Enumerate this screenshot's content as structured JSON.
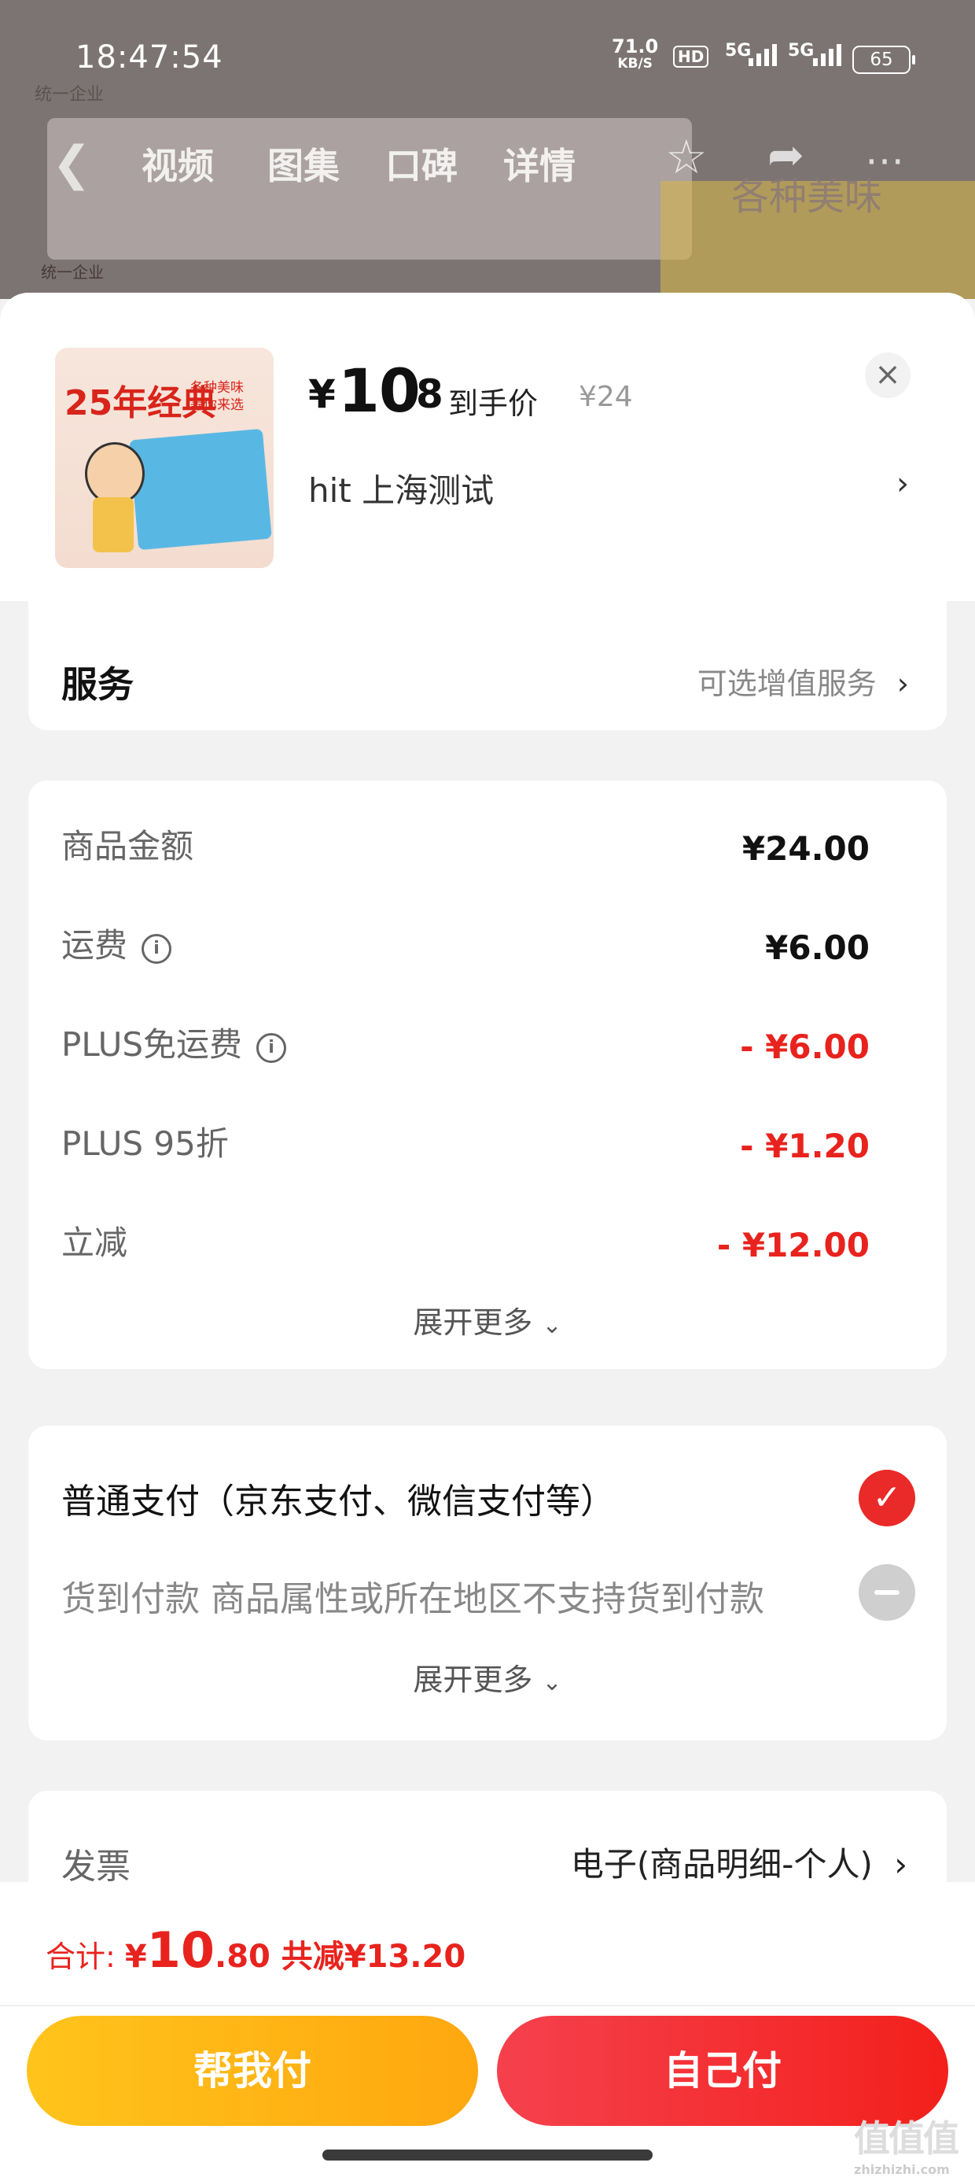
{
  "background": {
    "brand_top": "统一企业",
    "brand_bottom": "统一企业",
    "slogan": "各种美味"
  },
  "status_bar": {
    "time": "18:47:54",
    "net_speed": "71.0",
    "net_unit": "KB/S",
    "hd": "HD",
    "sig1": "5G",
    "sig2": "5G",
    "battery": "65"
  },
  "nav": {
    "tabs": [
      "视频",
      "图集",
      "口碑",
      "详情"
    ]
  },
  "product": {
    "thumb_title": "25年经典",
    "thumb_sub1": "各种美味",
    "thumb_sub2": "等你来选",
    "price_symbol": "¥",
    "price_int": "10",
    "price_dec": ".8",
    "price_label": "到手价",
    "original_price": "¥24",
    "address": "hit  上海测试"
  },
  "service": {
    "title": "服务",
    "right_label": "可选增值服务"
  },
  "fees": {
    "rows": [
      {
        "label": "商品金额",
        "value": "¥24.00"
      },
      {
        "label": "运费",
        "value": "¥6.00"
      },
      {
        "label": "PLUS免运费",
        "value": "- ¥6.00"
      },
      {
        "label": "PLUS 95折",
        "value": "- ¥1.20"
      },
      {
        "label": "立减",
        "value": "- ¥12.00"
      }
    ],
    "expand_label": "展开更多"
  },
  "payment": {
    "option1": "普通支付（京东支付、微信支付等）",
    "option2": "货到付款 商品属性或所在地区不支持货到付款",
    "expand_label": "展开更多"
  },
  "invoice": {
    "label": "发票",
    "value": "电子(商品明细-个人)"
  },
  "footer": {
    "total_label": "合计: ",
    "total_symbol": "¥",
    "total_int": "10",
    "total_dec": ".80",
    "discount_label": " 共减¥13.20",
    "friend_pay": "帮我付",
    "self_pay": "自己付"
  },
  "watermark": {
    "logo": "值值值",
    "site": "zhizhizhi.com"
  },
  "colors": {
    "accent_red": "#e8231e",
    "friend_yellow": "#ffb414",
    "self_red": "#f3301f"
  }
}
